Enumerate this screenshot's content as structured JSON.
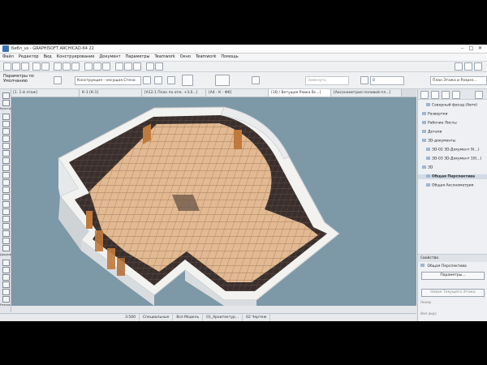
{
  "window": {
    "title": "Библ_us - GRAPHISOFT ARCHICAD-64 22",
    "controls": [
      "–",
      "□",
      "✕"
    ]
  },
  "menu": [
    "Файл",
    "Редактор",
    "Вид",
    "Конструирование",
    "Документ",
    "Параметры",
    "Teamwork",
    "Окно",
    "Teamwork",
    "Помощь"
  ],
  "toolbar": {
    "params_label": "Параметры по Умолчанию",
    "structure_dropdown": "Конструкция - несущая Стена",
    "layer_value": "Замкнуто",
    "zoom_value": "0",
    "plan_dropdown": "План Этажа и Разрез..."
  },
  "tabs": [
    {
      "label": "[1. 1-й этаж]",
      "active": false
    },
    {
      "label": "К-1 [К-1]",
      "active": false
    },
    {
      "label": "[А12.1 План по отм. +3.0...]",
      "active": false
    },
    {
      "label": "[А4 - К - Ф6]",
      "active": false
    },
    {
      "label": "[3D / Ветущая Ровка Вс...]",
      "active": true
    },
    {
      "label": "[Аксонометрия половой пл...]",
      "active": false
    }
  ],
  "toolbox": {
    "labels": [
      "Конструир",
      "Докумен",
      "Разное"
    ]
  },
  "statusbar": [
    "3:500",
    "Специальные",
    "Вся Модель",
    "01_Архитектур...",
    "02 Чертеж"
  ],
  "navigator": {
    "items": [
      {
        "label": "Северный фасад (Авто)",
        "indent": 2
      },
      {
        "label": "Развертки",
        "indent": 1
      },
      {
        "label": "Рабочие Листы",
        "indent": 1
      },
      {
        "label": "Детали",
        "indent": 1
      },
      {
        "label": "3D-документы",
        "indent": 1
      },
      {
        "label": "3D-02 3D-Документ 9(...)",
        "indent": 2
      },
      {
        "label": "3D-03 3D-Документ 10(...)",
        "indent": 2
      },
      {
        "label": "3D",
        "indent": 1
      },
      {
        "label": "Общая Перспектива",
        "indent": 2,
        "bold": true
      },
      {
        "label": "Общая Аксонометрия",
        "indent": 2
      }
    ]
  },
  "properties": {
    "header": "Свойства",
    "current_view": "Общая Перспектива",
    "params_button": "Параметры...",
    "new_view": "Новая Текущего Этажа",
    "label1": "Номер",
    "label2": "Имя вида"
  },
  "colors": {
    "viewport_bg": "#7d98a6",
    "floor_tile": "#e2b991",
    "dark_tile": "#3a2f2c",
    "wall_top": "#f2f2f0",
    "wall_side": "#d9dcdf",
    "door": "#c07a3c"
  }
}
